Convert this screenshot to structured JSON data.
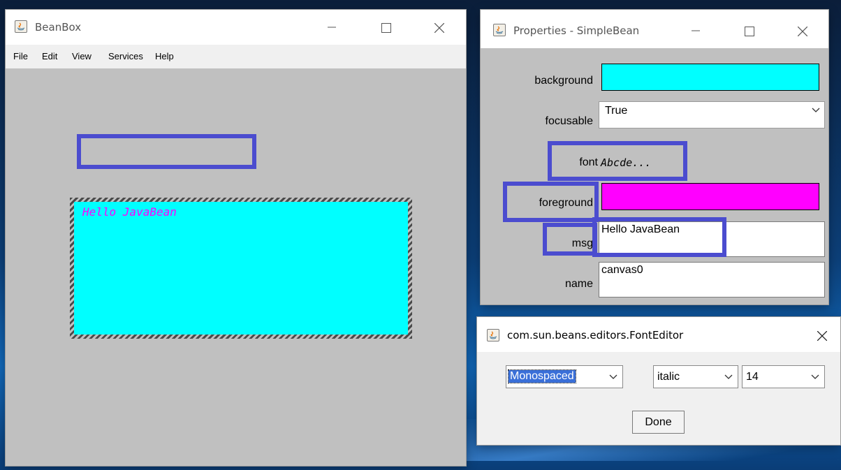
{
  "beanbox": {
    "title": "BeanBox",
    "menu": [
      "File",
      "Edit",
      "View",
      "Services",
      "Help"
    ],
    "bean_message": "Hello JavaBean",
    "bean_background": "#00ffff",
    "bean_foreground": "#ff00ff"
  },
  "properties": {
    "title": "Properties - SimpleBean",
    "rows": {
      "background": {
        "label": "background",
        "color": "#00ffff"
      },
      "focusable": {
        "label": "focusable",
        "value": "True"
      },
      "font": {
        "label": "font",
        "preview": "Abcde..."
      },
      "foreground": {
        "label": "foreground",
        "color": "#ff00ff"
      },
      "msg": {
        "label": "msg",
        "value": "Hello JavaBean"
      },
      "name": {
        "label": "name",
        "value": "canvas0"
      }
    }
  },
  "font_editor": {
    "title": "com.sun.beans.editors.FontEditor",
    "family": "Monospaced",
    "style": "italic",
    "size": "14",
    "done_label": "Done"
  },
  "colors": {
    "highlight": "#4b4ccf",
    "canvas_gray": "#c0c0c0"
  }
}
